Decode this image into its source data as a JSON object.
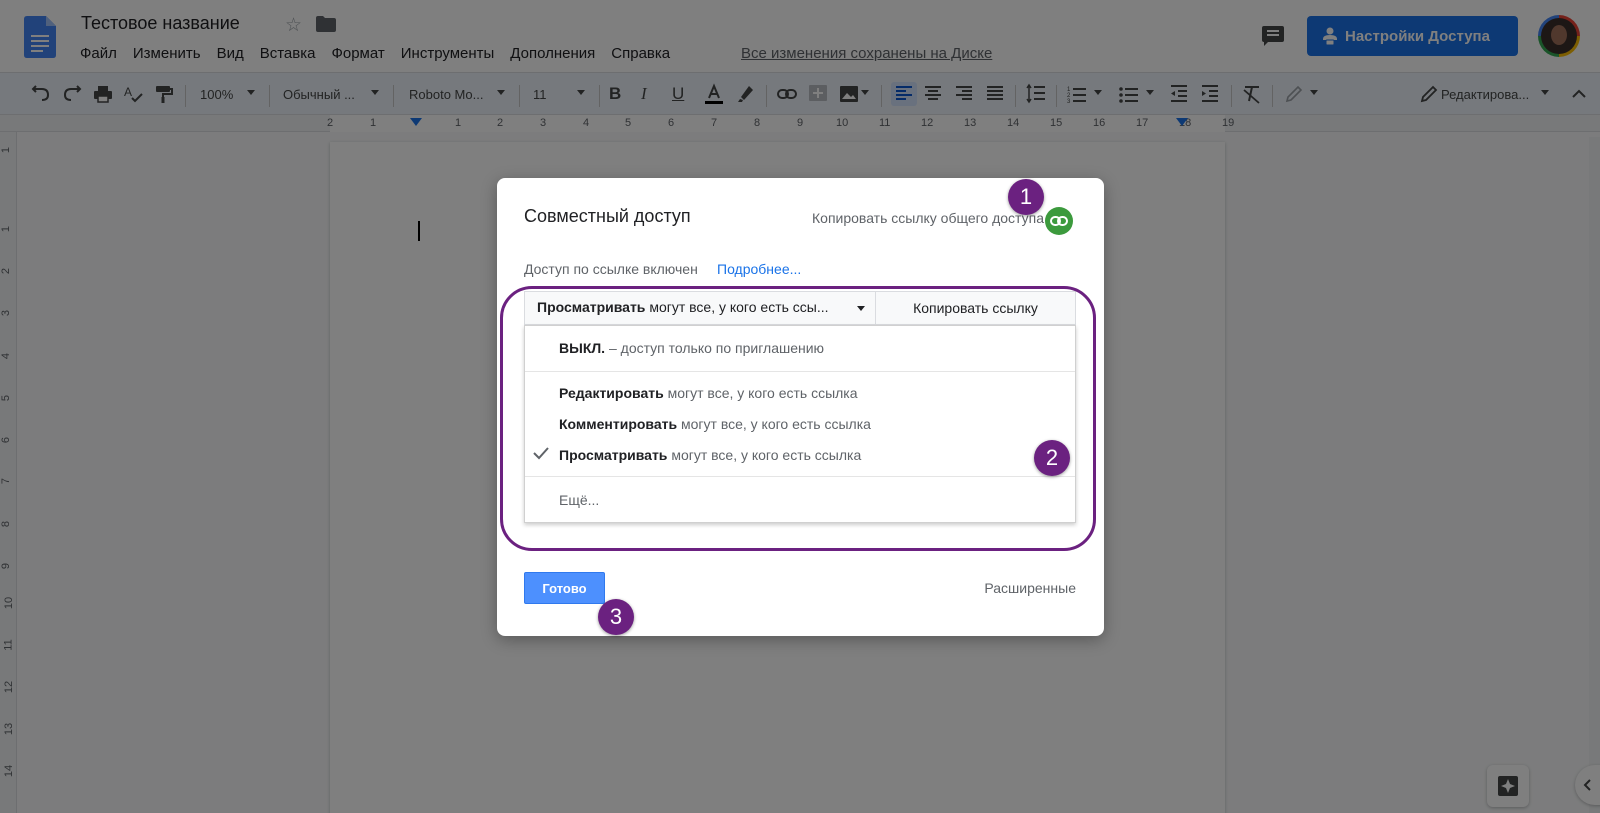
{
  "header": {
    "doc_title": "Тестовое название",
    "menu": [
      "Файл",
      "Изменить",
      "Вид",
      "Вставка",
      "Формат",
      "Инструменты",
      "Дополнения",
      "Справка"
    ],
    "saved_status": "Все изменения сохранены на Диске",
    "share_button": "Настройки Доступа",
    "brand_color": "#1a73e8"
  },
  "toolbar": {
    "zoom": "100%",
    "style": "Обычный ...",
    "font": "Roboto Mo...",
    "size": "11",
    "mode": "Редактирова..."
  },
  "ruler": {
    "h_ticks": [
      "2",
      "1",
      "1",
      "2",
      "3",
      "4",
      "5",
      "6",
      "7",
      "8",
      "9",
      "10",
      "11",
      "12",
      "13",
      "14",
      "15",
      "16",
      "17",
      "18",
      "19"
    ],
    "v_ticks": [
      "1",
      "1",
      "2",
      "3",
      "4",
      "5",
      "6",
      "7",
      "8",
      "9",
      "10",
      "11",
      "12",
      "13",
      "14"
    ]
  },
  "dialog": {
    "title": "Совместный доступ",
    "copy_public_link": "Копировать ссылку общего доступа",
    "link_status": "Доступ по ссылке включен",
    "more_link": "Подробнее...",
    "select_bold": "Просматривать",
    "select_rest": "могут все, у кого есть ссы...",
    "copy_link_button": "Копировать ссылку",
    "options": {
      "off_bold": "ВЫКЛ.",
      "off_rest": "– доступ только по приглашению",
      "edit_bold": "Редактировать",
      "edit_rest": "могут все, у кого есть ссылка",
      "comment_bold": "Комментировать",
      "comment_rest": "могут все, у кого есть ссылка",
      "view_bold": "Просматривать",
      "view_rest": "могут все, у кого есть ссылка",
      "more": "Ещё..."
    },
    "selected_option": "view",
    "done_button": "Готово",
    "advanced_link": "Расширенные"
  },
  "annotations": {
    "badge_1": "1",
    "badge_2": "2",
    "badge_3": "3",
    "color": "#6b2180"
  }
}
